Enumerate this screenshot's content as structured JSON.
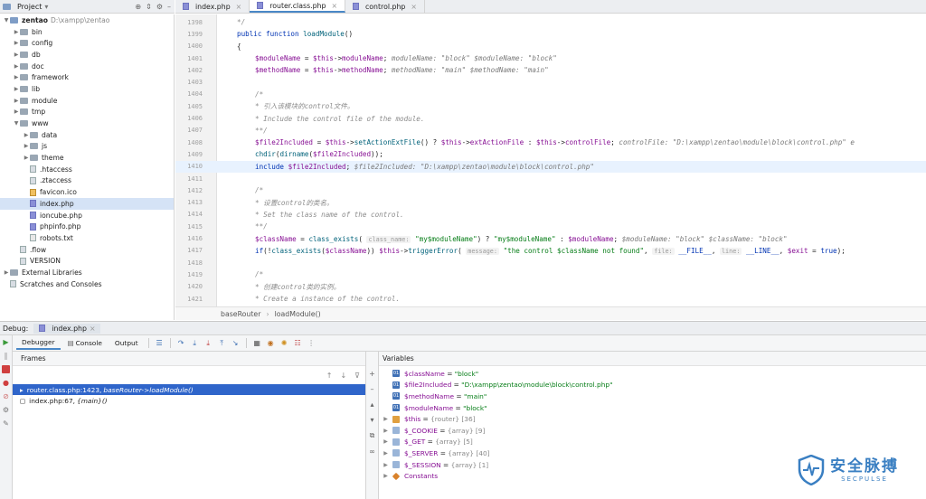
{
  "project_panel": {
    "title": "Project",
    "tree": [
      {
        "label": "zentao",
        "note": "D:\\xampp\\zentao",
        "depth": 0,
        "kind": "folder-blue",
        "arrow": "▼",
        "bold": true
      },
      {
        "label": "bin",
        "depth": 1,
        "kind": "folder",
        "arrow": "▶"
      },
      {
        "label": "config",
        "depth": 1,
        "kind": "folder",
        "arrow": "▶"
      },
      {
        "label": "db",
        "depth": 1,
        "kind": "folder",
        "arrow": "▶"
      },
      {
        "label": "doc",
        "depth": 1,
        "kind": "folder",
        "arrow": "▶"
      },
      {
        "label": "framework",
        "depth": 1,
        "kind": "folder",
        "arrow": "▶"
      },
      {
        "label": "lib",
        "depth": 1,
        "kind": "folder",
        "arrow": "▶"
      },
      {
        "label": "module",
        "depth": 1,
        "kind": "folder",
        "arrow": "▶"
      },
      {
        "label": "tmp",
        "depth": 1,
        "kind": "folder",
        "arrow": "▶"
      },
      {
        "label": "www",
        "depth": 1,
        "kind": "folder",
        "arrow": "▼"
      },
      {
        "label": "data",
        "depth": 2,
        "kind": "folder",
        "arrow": "▶"
      },
      {
        "label": "js",
        "depth": 2,
        "kind": "folder",
        "arrow": "▶"
      },
      {
        "label": "theme",
        "depth": 2,
        "kind": "folder",
        "arrow": "▶"
      },
      {
        "label": ".htaccess",
        "depth": 2,
        "kind": "file",
        "arrow": ""
      },
      {
        "label": ".ztaccess",
        "depth": 2,
        "kind": "file",
        "arrow": ""
      },
      {
        "label": "favicon.ico",
        "depth": 2,
        "kind": "ico",
        "arrow": ""
      },
      {
        "label": "index.php",
        "depth": 2,
        "kind": "php",
        "arrow": "",
        "selected": true
      },
      {
        "label": "ioncube.php",
        "depth": 2,
        "kind": "php",
        "arrow": ""
      },
      {
        "label": "phpinfo.php",
        "depth": 2,
        "kind": "php",
        "arrow": ""
      },
      {
        "label": "robots.txt",
        "depth": 2,
        "kind": "txt",
        "arrow": ""
      },
      {
        "label": ".flow",
        "depth": 1,
        "kind": "file",
        "arrow": ""
      },
      {
        "label": "VERSION",
        "depth": 1,
        "kind": "file",
        "arrow": ""
      },
      {
        "label": "External Libraries",
        "depth": 0,
        "kind": "lib",
        "arrow": "▶"
      },
      {
        "label": "Scratches and Consoles",
        "depth": 0,
        "kind": "scratch",
        "arrow": ""
      }
    ]
  },
  "editor_tabs": [
    {
      "label": "index.php",
      "active": false
    },
    {
      "label": "router.class.php",
      "active": true
    },
    {
      "label": "control.php",
      "active": false
    }
  ],
  "code_lines": [
    {
      "n": "1398",
      "html": "<span class=\"cm\">*/</span>",
      "indent": 1
    },
    {
      "n": "1399",
      "html": "<span class=\"kw\">public function</span> <span class=\"fn\">loadModule</span>()",
      "indent": 1
    },
    {
      "n": "1400",
      "html": "{",
      "indent": 1
    },
    {
      "n": "1401",
      "html": "<span class=\"var\">$moduleName</span> = <span class=\"var\">$this</span>-&gt;<span class=\"var\">moduleName</span>;  <span class=\"hint\">moduleName: \"block\"  $moduleName: \"block\"</span>",
      "indent": 2
    },
    {
      "n": "1402",
      "html": "<span class=\"var\">$methodName</span> = <span class=\"var\">$this</span>-&gt;<span class=\"var\">methodName</span>;  <span class=\"hint\">methodName: \"main\"  $methodName: \"main\"</span>",
      "indent": 2
    },
    {
      "n": "1403",
      "html": "",
      "indent": 2
    },
    {
      "n": "1404",
      "html": "<span class=\"cm\">/*</span>",
      "indent": 2
    },
    {
      "n": "1405",
      "html": "<span class=\"cm\"> * 引入该模块的control文件。</span>",
      "indent": 2
    },
    {
      "n": "1406",
      "html": "<span class=\"cm\"> * Include the control file of the module.</span>",
      "indent": 2
    },
    {
      "n": "1407",
      "html": "<span class=\"cm\"> **/</span>",
      "indent": 2
    },
    {
      "n": "1408",
      "html": "<span class=\"var\">$file2Included</span> = <span class=\"var\">$this</span>-&gt;<span class=\"fn\">setActionExtFile</span>() ? <span class=\"var\">$this</span>-&gt;<span class=\"var\">extActionFile</span> : <span class=\"var\">$this</span>-&gt;<span class=\"var\">controlFile</span>;  <span class=\"hint\">controlFile: \"D:\\xampp\\zentao\\module\\block\\control.php\"  e</span>",
      "indent": 2
    },
    {
      "n": "1409",
      "html": "<span class=\"fn\">chdir</span>(<span class=\"fn\">dirname</span>(<span class=\"var\">$file2Included</span>));",
      "indent": 2
    },
    {
      "n": "1410",
      "html": "<span class=\"kw\">include</span> <span class=\"var\">$file2Included</span>;  <span class=\"hint\">$file2Included: \"D:\\xampp\\zentao\\module\\block\\control.php\"</span>",
      "indent": 2,
      "highlight": true
    },
    {
      "n": "1411",
      "html": "",
      "indent": 2
    },
    {
      "n": "1412",
      "html": "<span class=\"cm\">/*</span>",
      "indent": 2
    },
    {
      "n": "1413",
      "html": "<span class=\"cm\"> * 设置control的类名。</span>",
      "indent": 2
    },
    {
      "n": "1414",
      "html": "<span class=\"cm\"> * Set the class name of the control.</span>",
      "indent": 2
    },
    {
      "n": "1415",
      "html": "<span class=\"cm\"> **/</span>",
      "indent": 2
    },
    {
      "n": "1416",
      "html": "<span class=\"var\">$className</span> = <span class=\"fn\">class_exists</span>( <span class=\"ph\">class_name:</span> <span class=\"str\">\"my$moduleName\"</span>) ? <span class=\"str\">\"my$moduleName\"</span> : <span class=\"var\">$moduleName</span>;  <span class=\"hint\">$moduleName: \"block\"  $className: \"block\"</span>",
      "indent": 2
    },
    {
      "n": "1417",
      "html": "<span class=\"kw\">if</span>(!<span class=\"fn\">class_exists</span>(<span class=\"var\">$className</span>)) <span class=\"var\">$this</span>-&gt;<span class=\"fn\">triggerError</span>( <span class=\"ph\">message:</span> <span class=\"str\">\"the control $className not found\"</span>,  <span class=\"ph\">file:</span> <span class=\"kw\">__FILE__</span>,  <span class=\"ph\">line:</span> <span class=\"kw\">__LINE__</span>, <span class=\"var\">$exit</span> = <span class=\"kw\">true</span>);",
      "indent": 2
    },
    {
      "n": "1418",
      "html": "",
      "indent": 2
    },
    {
      "n": "1419",
      "html": "<span class=\"cm\">/*</span>",
      "indent": 2
    },
    {
      "n": "1420",
      "html": "<span class=\"cm\"> * 创建control类的实例。</span>",
      "indent": 2
    },
    {
      "n": "1421",
      "html": "<span class=\"cm\"> * Create a instance of the control.</span>",
      "indent": 2
    }
  ],
  "breadcrumb": {
    "first": "baseRouter",
    "sep": "›",
    "second": "loadModule()"
  },
  "debug": {
    "title": "Debug:",
    "session_tab": "index.php",
    "tabs": [
      "Debugger",
      "Console",
      "Output"
    ],
    "frames_title": "Frames",
    "frames": [
      {
        "file": "router.class.php:1423,",
        "context": "baseRouter->loadModule()",
        "selected": true
      },
      {
        "file": "index.php:67,",
        "context": "{main}()",
        "selected": false
      }
    ],
    "variables_title": "Variables",
    "variables": [
      {
        "name": "$className",
        "eq": " = ",
        "value": "\"block\"",
        "type": "",
        "kind": "v",
        "expand": false
      },
      {
        "name": "$file2Included",
        "eq": " = ",
        "value": "\"D:\\xampp\\zentao\\module\\block\\control.php\"",
        "type": "",
        "kind": "v",
        "expand": false
      },
      {
        "name": "$methodName",
        "eq": " = ",
        "value": "\"main\"",
        "type": "",
        "kind": "v",
        "expand": false
      },
      {
        "name": "$moduleName",
        "eq": " = ",
        "value": "\"block\"",
        "type": "",
        "kind": "v",
        "expand": false
      },
      {
        "name": "$this",
        "eq": " = ",
        "value": "",
        "type": "{router} [36]",
        "kind": "o",
        "expand": true
      },
      {
        "name": "$_COOKIE",
        "eq": " = ",
        "value": "",
        "type": "{array} [9]",
        "kind": "a",
        "expand": true
      },
      {
        "name": "$_GET",
        "eq": " = ",
        "value": "",
        "type": "{array} [5]",
        "kind": "a",
        "expand": true
      },
      {
        "name": "$_SERVER",
        "eq": " = ",
        "value": "",
        "type": "{array} [40]",
        "kind": "a",
        "expand": true
      },
      {
        "name": "$_SESSION",
        "eq": " = ",
        "value": "",
        "type": "{array} [1]",
        "kind": "a",
        "expand": true
      },
      {
        "name": "Constants",
        "eq": "",
        "value": "",
        "type": "",
        "kind": "c",
        "expand": true
      }
    ]
  },
  "watermark": {
    "title": "安全脉搏",
    "subtitle": "SECPULSE"
  },
  "colors": {
    "accent": "#4a88c7",
    "selection": "#2f65ca",
    "string": "#067d17",
    "keyword": "#0033b3",
    "variable": "#871094"
  }
}
